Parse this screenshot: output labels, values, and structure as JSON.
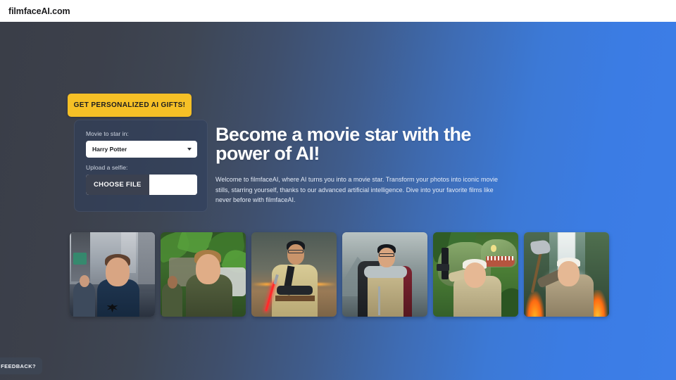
{
  "header": {
    "brand": "filmfaceAI.com"
  },
  "cta": {
    "label": "GET PERSONALIZED AI GIFTS!",
    "color": "#f6c026"
  },
  "form": {
    "movie_label": "Movie to star in:",
    "movie_selected": "Harry Potter",
    "movie_options": [
      "Harry Potter"
    ],
    "upload_label": "Upload a selfie:",
    "choose_file_label": "CHOOSE FILE",
    "file_name": ""
  },
  "hero": {
    "headline": "Become a movie star with the power of AI!",
    "subcopy": "Welcome to filmfaceAI, where AI turns you into a movie star. Transform your photos into iconic movie stills, starring yourself, thanks to our advanced artificial intelligence. Dive into your favorite films like never before with filmfaceAI."
  },
  "gallery": {
    "items": [
      {
        "alt": "Superhero in city street with spider emblem suit"
      },
      {
        "alt": "Adventurer in tropical jungle with safari shirt"
      },
      {
        "alt": "Jedi in tan robes holding a red lightsaber at sunset"
      },
      {
        "alt": "Knight in plate armor with dark and red cloak"
      },
      {
        "alt": "Man with pistol fleeing a green tyrannosaurus"
      },
      {
        "alt": "Warrior raising an axe before a waterfall and flames"
      }
    ]
  },
  "feedback": {
    "label": "FEEDBACK?"
  },
  "colors": {
    "bg_left": "#3a3e48",
    "bg_right": "#3d7ee8",
    "accent": "#f6c026",
    "card": "#2e3e5d",
    "file_button": "#3b4150",
    "header_bg": "#ffffff"
  }
}
